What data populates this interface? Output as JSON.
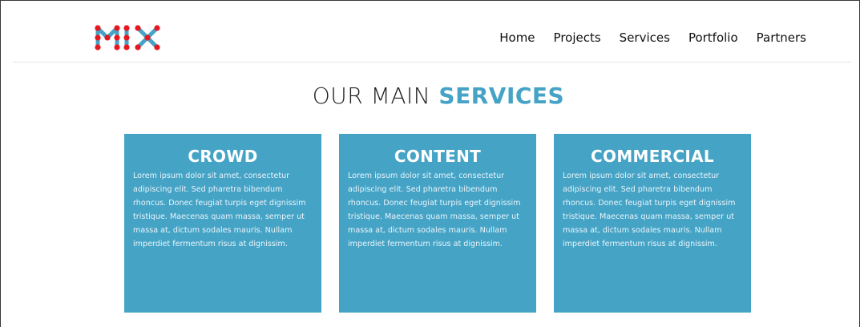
{
  "header": {
    "logo_text": "MIX",
    "nav": [
      "Home",
      "Projects",
      "Services",
      "Portfolio",
      "Partners"
    ]
  },
  "section": {
    "title_light": "OUR MAIN",
    "title_bold": "SERVICES"
  },
  "cards": [
    {
      "title": "CROWD",
      "body": "Lorem ipsum dolor sit amet, consectetur adipiscing elit. Sed pharetra bibendum rhoncus. Donec feugiat turpis eget dignissim tristique. Maecenas quam massa, semper ut massa at, dictum sodales mauris. Nullam imperdiet fermentum risus at dignissim."
    },
    {
      "title": "CONTENT",
      "body": "Lorem ipsum dolor sit amet, consectetur adipiscing elit. Sed pharetra bibendum rhoncus. Donec feugiat turpis eget dignissim tristique. Maecenas quam massa, semper ut massa at, dictum sodales mauris. Nullam imperdiet fermentum risus at dignissim."
    },
    {
      "title": "COMMERCIAL",
      "body": "Lorem ipsum dolor sit amet, consectetur adipiscing elit. Sed pharetra bibendum rhoncus. Donec feugiat turpis eget dignissim tristique. Maecenas quam massa, semper ut massa at, dictum sodales mauris. Nullam imperdiet fermentum risus at dignissim."
    }
  ],
  "colors": {
    "accent": "#45a3c6",
    "logo_dot": "#e8171f",
    "logo_line": "#45a3c6"
  }
}
